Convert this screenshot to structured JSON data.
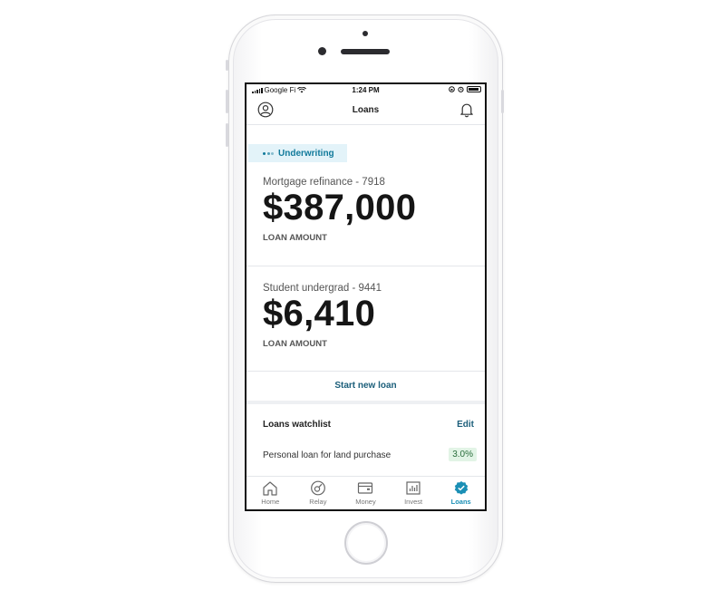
{
  "status_bar": {
    "carrier": "Google Fi",
    "time": "1:24 PM"
  },
  "header": {
    "title": "Loans",
    "left_icon": "profile-icon",
    "right_icon": "bell-icon"
  },
  "status_badge": {
    "label": "Underwriting",
    "color": "#117a9b"
  },
  "loans": [
    {
      "name": "Mortgage refinance - 7918",
      "amount": "$387,000",
      "amount_label": "LOAN AMOUNT"
    },
    {
      "name": "Student undergrad - 9441",
      "amount": "$6,410",
      "amount_label": "LOAN AMOUNT"
    }
  ],
  "start_new_loan": "Start new loan",
  "watchlist": {
    "title": "Loans watchlist",
    "edit_label": "Edit",
    "items": [
      {
        "label": "Personal loan for land purchase",
        "rate": "3.0%"
      }
    ]
  },
  "tab_bar": {
    "active": "Loans",
    "accent": "#1a8fb5",
    "tabs": [
      {
        "label": "Home",
        "icon": "home-icon"
      },
      {
        "label": "Relay",
        "icon": "relay-icon"
      },
      {
        "label": "Money",
        "icon": "wallet-icon"
      },
      {
        "label": "Invest",
        "icon": "chart-icon"
      },
      {
        "label": "Loans",
        "icon": "loans-badge-icon"
      }
    ]
  }
}
